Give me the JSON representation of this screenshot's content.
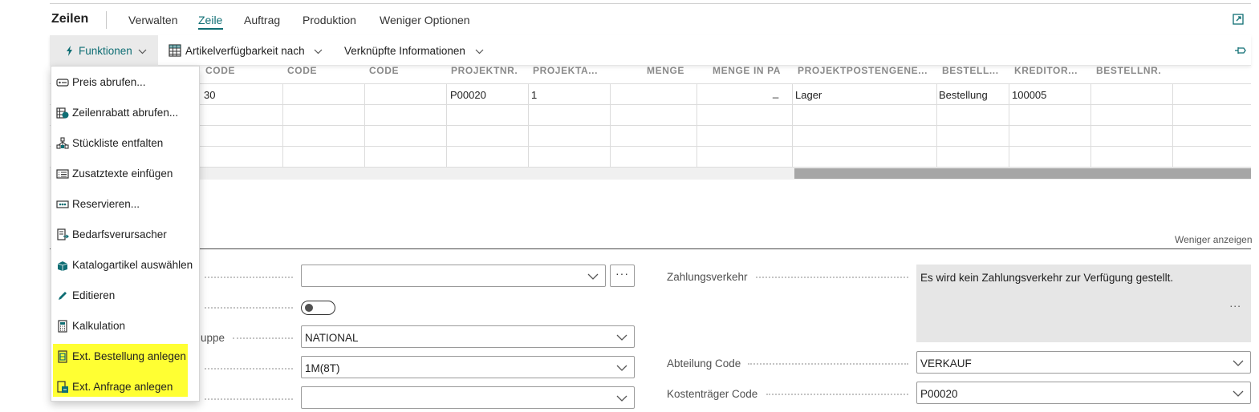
{
  "header": {
    "title": "Zeilen",
    "tabs": [
      {
        "label": "Verwalten"
      },
      {
        "label": "Zeile"
      },
      {
        "label": "Auftrag"
      },
      {
        "label": "Produktion"
      },
      {
        "label": "Weniger Optionen"
      }
    ],
    "active_tab": "Zeile"
  },
  "actionbar": {
    "functions_label": "Funktionen",
    "availability_label": "Artikelverfügbarkeit nach",
    "related_label": "Verknüpfte Informationen"
  },
  "grid": {
    "columns": [
      "CODE",
      "CODE",
      "CODE",
      "PROJEKTNR.",
      "PROJEKTA...",
      "MENGE",
      "MENGE IN PA",
      "PROJEKTPOSTENGENE...",
      "BESTELL...",
      "KREDITOR...",
      "BESTELLNR."
    ],
    "row1": {
      "code": "30",
      "projektnr": "P00020",
      "projekta": "1",
      "menge_in_pa": "_",
      "projektpostengene": "Lager",
      "bestell": "Bestellung",
      "kreditor": "100005"
    }
  },
  "menu": {
    "items": [
      {
        "label": "Preis abrufen...",
        "icon": "price-tag-icon"
      },
      {
        "label": "Zeilenrabatt abrufen...",
        "icon": "line-discount-icon"
      },
      {
        "label": "Stückliste entfalten",
        "icon": "bom-explode-icon"
      },
      {
        "label": "Zusatztexte einfügen",
        "icon": "extended-text-icon"
      },
      {
        "label": "Reservieren...",
        "icon": "reserve-icon"
      },
      {
        "label": "Bedarfsverursacher",
        "icon": "order-tracking-icon"
      },
      {
        "label": "Katalogartikel auswählen",
        "icon": "catalog-icon"
      },
      {
        "label": "Editieren",
        "icon": "edit-pencil-icon"
      },
      {
        "label": "Kalkulation",
        "icon": "calculator-icon"
      },
      {
        "label": "Ext. Bestellung anlegen",
        "icon": "purchase-order-icon",
        "highlighted": true
      },
      {
        "label": "Ext. Anfrage anlegen",
        "icon": "purchase-quote-icon",
        "highlighted": true
      }
    ],
    "highlight_color": "#ffff33"
  },
  "details": {
    "show_less": "Weniger anzeigen",
    "label_group_partial": "uppe",
    "group_value": "NATIONAL",
    "terms_value": "1M(8T)",
    "payment_label": "Zahlungsverkehr",
    "payment_text": "Es wird kein Zahlungsverkehr zur Verfügung gestellt.",
    "department_label": "Abteilung Code",
    "department_value": "VERKAUF",
    "cost_label": "Kostenträger Code",
    "cost_value": "P00020",
    "more_symbol": "...",
    "dots_button": "···"
  },
  "colors": {
    "accent": "#0f6e74",
    "menu_highlight": "#ffff33",
    "function_icon": "#0f6e74"
  }
}
